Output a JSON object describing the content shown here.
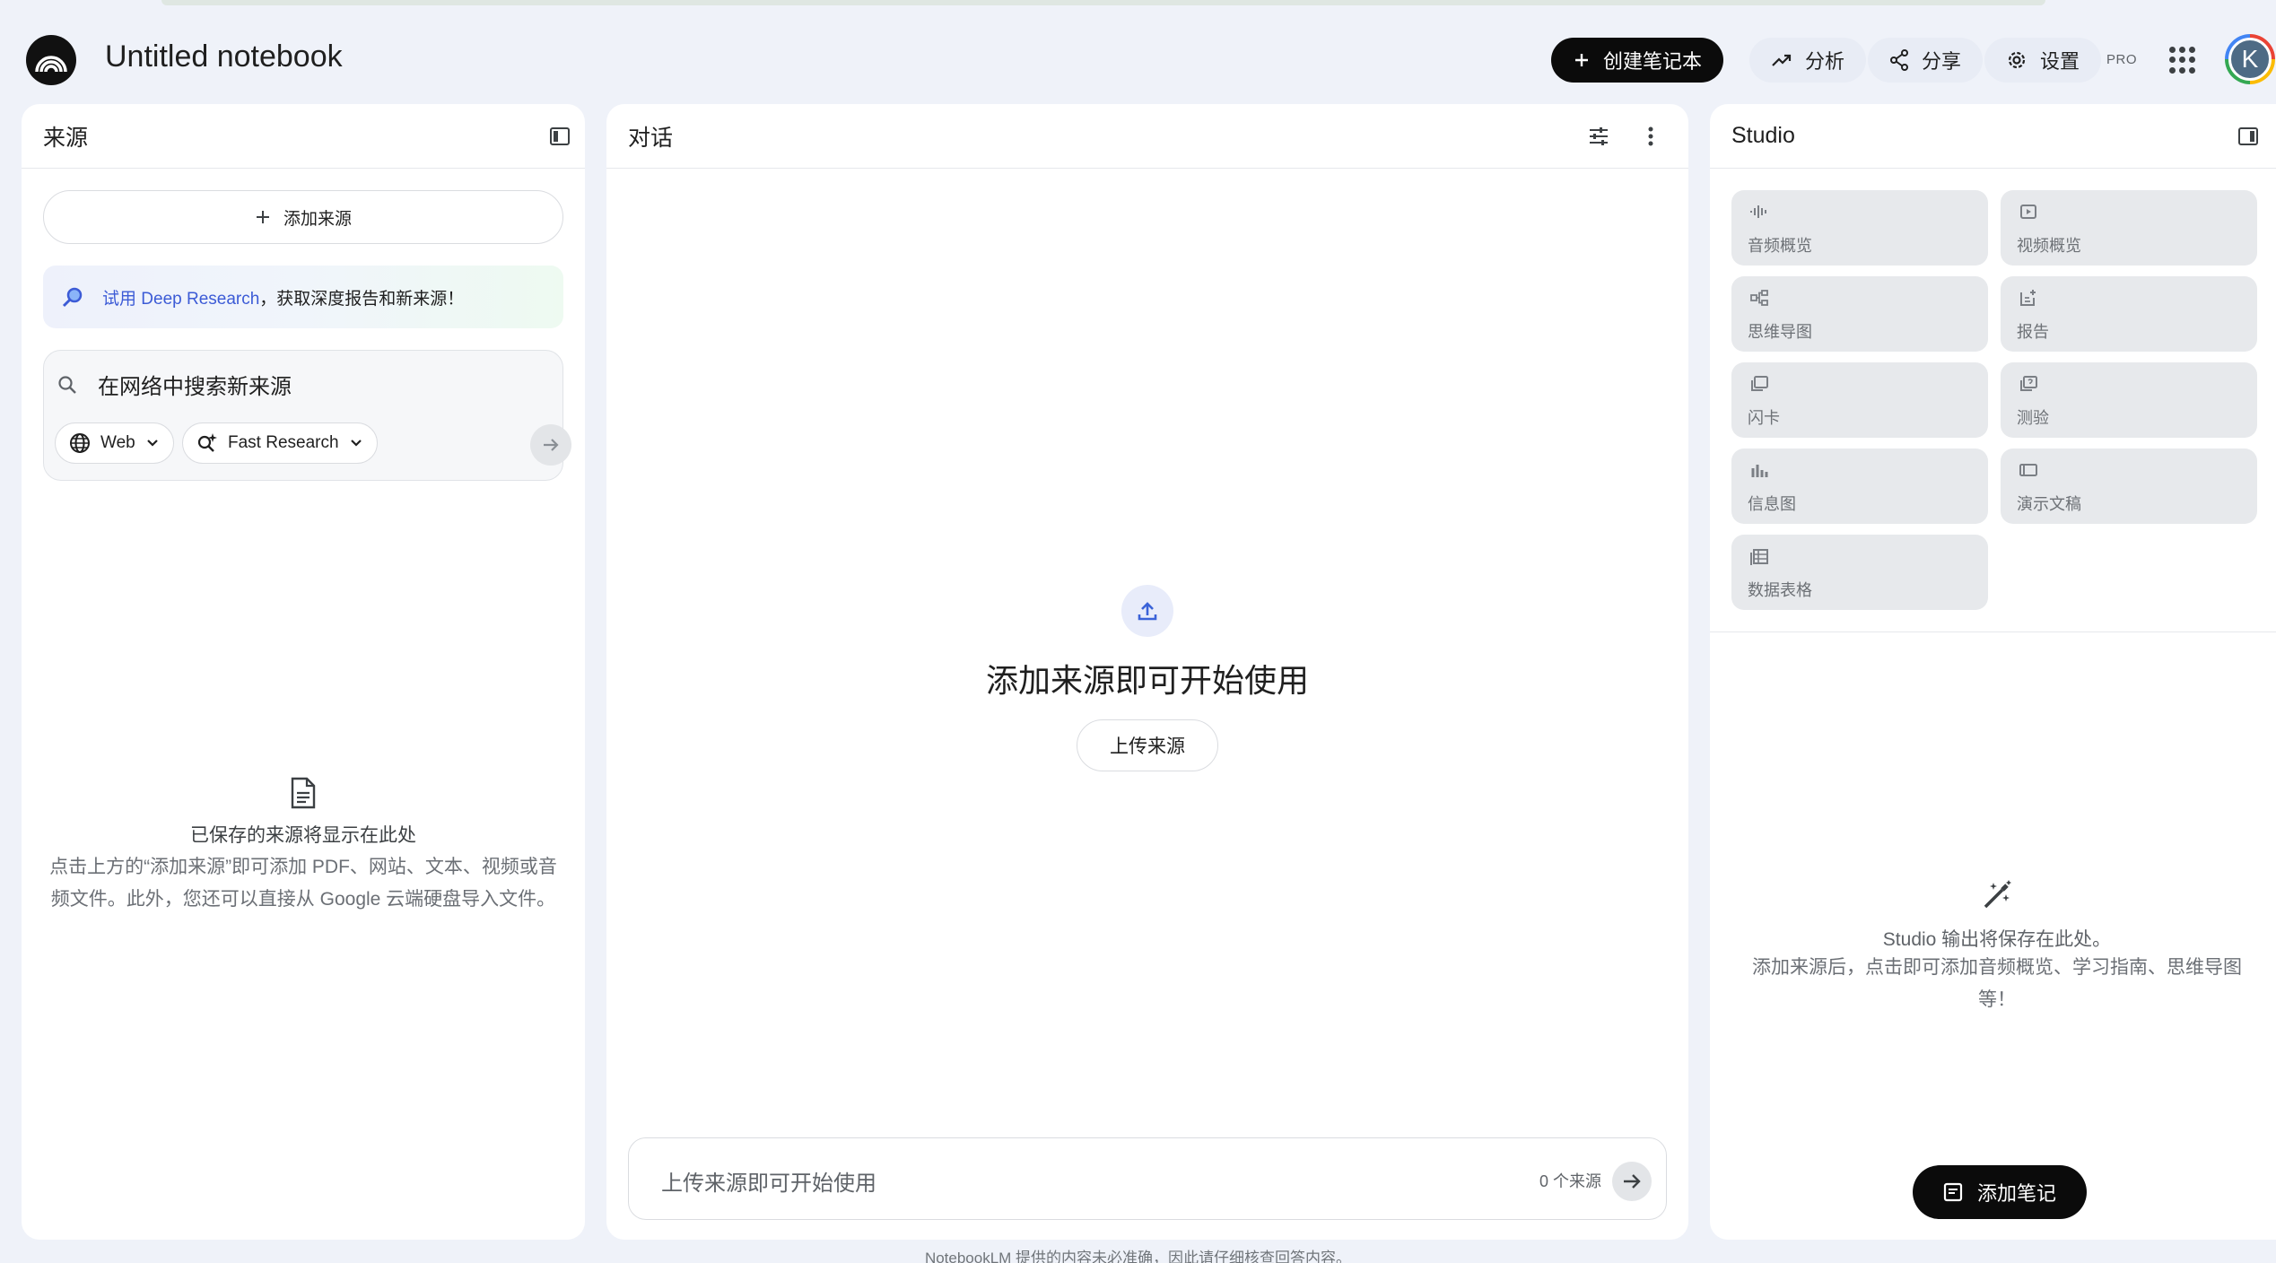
{
  "header": {
    "title": "Untitled notebook",
    "create_label": "创建笔记本",
    "analytics_label": "分析",
    "share_label": "分享",
    "settings_label": "设置",
    "pro_badge": "PRO",
    "avatar_initial": "K"
  },
  "sources": {
    "title": "来源",
    "add_label": "添加来源",
    "deep_research_link": "试用 Deep Research",
    "deep_research_text": "，获取深度报告和新来源！",
    "search_placeholder": "在网络中搜索新来源",
    "web_chip": "Web",
    "research_chip": "Fast Research",
    "empty_title": "已保存的来源将显示在此处",
    "empty_desc": "点击上方的“添加来源”即可添加 PDF、网站、文本、视频或音频文件。此外，您还可以直接从 Google 云端硬盘导入文件。"
  },
  "chat": {
    "title": "对话",
    "empty_title": "添加来源即可开始使用",
    "upload_label": "上传来源",
    "input_placeholder": "上传来源即可开始使用",
    "source_count": "0 个来源"
  },
  "studio": {
    "title": "Studio",
    "tiles": [
      {
        "label": "音频概览",
        "icon": "audio-waveform-icon"
      },
      {
        "label": "视频概览",
        "icon": "video-icon"
      },
      {
        "label": "思维导图",
        "icon": "mind-map-icon"
      },
      {
        "label": "报告",
        "icon": "report-icon"
      },
      {
        "label": "闪卡",
        "icon": "flashcards-icon"
      },
      {
        "label": "测验",
        "icon": "quiz-icon"
      },
      {
        "label": "信息图",
        "icon": "infographic-icon"
      },
      {
        "label": "演示文稿",
        "icon": "slides-icon"
      },
      {
        "label": "数据表格",
        "icon": "data-table-icon"
      }
    ],
    "empty_title": "Studio 输出将保存在此处。",
    "empty_desc": "添加来源后，点击即可添加音频概览、学习指南、思维导图等！",
    "add_note_label": "添加笔记"
  },
  "footer": {
    "disclaimer": "NotebookLM 提供的内容未必准确，因此请仔细核查回答内容。"
  },
  "colors": {
    "background": "#eff2f9",
    "primary_button": "#0b0b0b",
    "link_blue": "#3c5bd6"
  }
}
